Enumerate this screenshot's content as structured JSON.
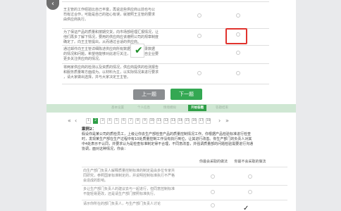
{
  "nav": {
    "back_label": "‹"
  },
  "top_rows": [
    {
      "text": "王主管的工作经验比自己丰富，再说这些供应商以前也与公\n司有过合作，可能是自己的担心有误，就按照王主管的要求\n由供应商执行。"
    },
    {
      "text": "为了保证产品的质量和按期交货，向市场部经理汇报情况，让\n他们再多了解下情况，要用的供应商应该遵照公司的规章制度\n确定了。向王主管提出，从而通过合适的供应商。"
    },
    {
      "text": "通过邮件向王主管详细陈述供应商所有数据和合作记录数据\n的情况和问题，希望他能够对此进行关注，提出将来自企业要\n更多关注供应商的情况。"
    },
    {
      "text": "将两家供应商的检测以及资质的情况，供应商提供的检测报告\n和服务质量等方面成为。以材料为主，以实际情况来进行要求\n，请大家做出选择，并与大家决定王主管。"
    }
  ],
  "buttons": {
    "prev": "上一题",
    "next": "下一题"
  },
  "steps": [
    "基本设置",
    "个人信息",
    "情境模拟",
    "开始答题",
    "答题结束"
  ],
  "pager": {
    "pages": [
      "1",
      "2",
      "3",
      "4",
      "5",
      "6",
      "7",
      "8",
      "9",
      "10",
      "11",
      "12",
      "13",
      "14",
      "15",
      "16",
      "17",
      "18"
    ],
    "current": "2"
  },
  "case": {
    "title": "案例2：",
    "body": "假设你是某公司的质检员工，上级让你去生产部检查产品的质量控制情况工作。你根据产品检验标准进行检查\n时，发现某生产部在生产过程中有10处质量控制工作没有执行到位，让其进行改善。你生产部门的负责人对其\n中4处表示不认同，并要求认为是检查标准制定得不合理，不同意改善，并强调质量部的问题检验需要进行沟通\n协调，面对这种情况，你会："
  },
  "columns": [
    "你最会采取的做法",
    "你最不会采取的做法"
  ],
  "bottom_rows": [
    {
      "text": "向生产部门负责人解释质量控制标准的制定是由多位专家共\n同研究，参照国家标准制定的，并说明控制标准执行不严格\n会造成的影响。"
    },
    {
      "text": "多让生产部门负责人的建议去与一起进行，但同意控制标准\n不能轻易更改，还是请生产部门按照标准执行。"
    },
    {
      "text": "请示你所在的部门负责人，与生产部门负责人讨论"
    }
  ],
  "colors": {
    "accent": "#2e9e46",
    "highlight": "#e0332e"
  },
  "icons": {
    "check": "check-icon",
    "back": "back-arrow-icon"
  }
}
